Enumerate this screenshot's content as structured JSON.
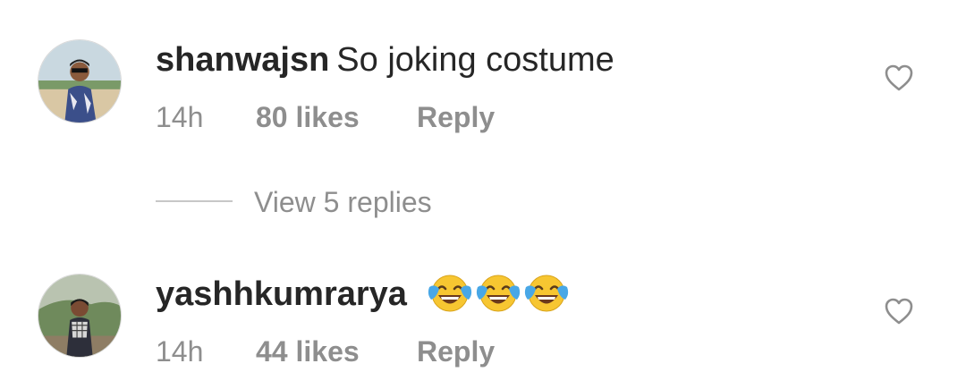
{
  "comments": [
    {
      "username": "shanwajsn",
      "text": "So joking costume",
      "time": "14h",
      "likes": "80 likes",
      "reply_label": "Reply",
      "avatar_icon": "user-avatar-photo",
      "like_icon": "heart-outline-icon"
    },
    {
      "username": "yashhkumrarya",
      "text": "",
      "emoji": [
        "face-with-tears-of-joy",
        "face-with-tears-of-joy",
        "face-with-tears-of-joy"
      ],
      "time": "14h",
      "likes": "44 likes",
      "reply_label": "Reply",
      "avatar_icon": "user-avatar-photo",
      "like_icon": "heart-outline-icon"
    }
  ],
  "view_replies": "View 5 replies",
  "colors": {
    "primary_text": "#262626",
    "secondary_text": "#8e8e8e",
    "divider": "#c7c7c7",
    "background": "#ffffff"
  }
}
